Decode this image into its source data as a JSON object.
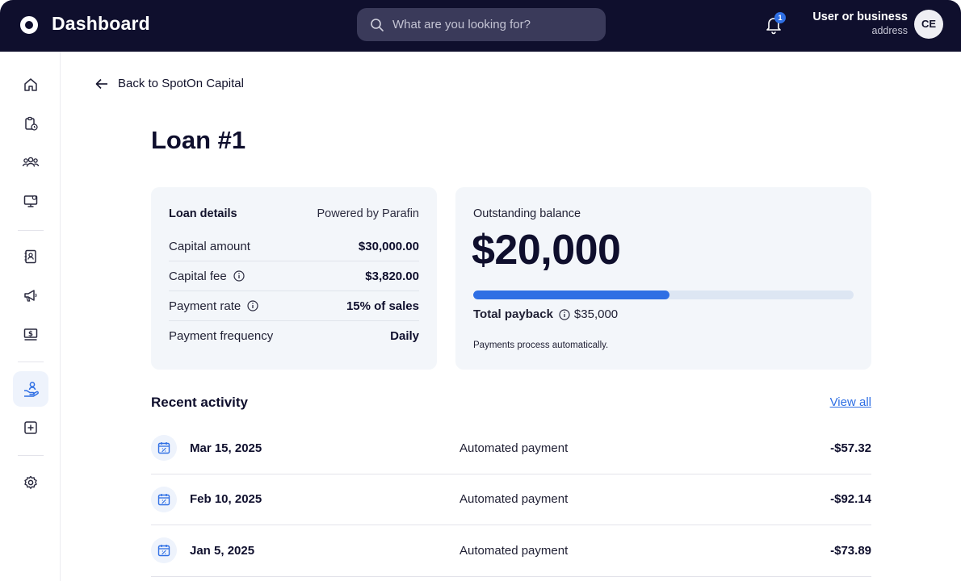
{
  "header": {
    "title": "Dashboard",
    "search_placeholder": "What are you looking for?",
    "notification_count": "1",
    "user_name": "User or business",
    "user_sub": "address",
    "avatar_initials": "CE"
  },
  "sidebar": {
    "items": [
      {
        "icon": "home-icon"
      },
      {
        "icon": "clipboard-clock-icon"
      },
      {
        "icon": "users-icon"
      },
      {
        "icon": "monitor-settings-icon"
      },
      {
        "icon": "contacts-book-icon"
      },
      {
        "icon": "megaphone-icon"
      },
      {
        "icon": "dollar-bill-icon"
      },
      {
        "icon": "hand-user-icon",
        "active": true
      },
      {
        "icon": "plus-square-icon"
      },
      {
        "icon": "gear-icon"
      }
    ]
  },
  "main": {
    "back_label": "Back to SpotOn Capital",
    "page_title": "Loan #1",
    "loan_details": {
      "title": "Loan details",
      "powered_by": "Powered by Parafin",
      "rows": [
        {
          "label": "Capital amount",
          "value": "$30,000.00",
          "info": false
        },
        {
          "label": "Capital fee",
          "value": "$3,820.00",
          "info": true
        },
        {
          "label": "Payment rate",
          "value": "15% of sales",
          "info": true
        },
        {
          "label": "Payment frequency",
          "value": "Daily",
          "info": false
        }
      ]
    },
    "balance": {
      "label": "Outstanding balance",
      "amount": "$20,000",
      "progress_fraction": 0.515,
      "payback_label": "Total payback",
      "payback_value": "$35,000",
      "note": "Payments process automatically."
    },
    "recent": {
      "title": "Recent activity",
      "view_all": "View all",
      "items": [
        {
          "date": "Mar 15, 2025",
          "description": "Automated payment",
          "amount": "-$57.32"
        },
        {
          "date": "Feb 10, 2025",
          "description": "Automated payment",
          "amount": "-$92.14"
        },
        {
          "date": "Jan 5, 2025",
          "description": "Automated payment",
          "amount": "-$73.89"
        }
      ]
    }
  },
  "colors": {
    "topbar": "#0f0f2d",
    "accent": "#2f6fe4",
    "card": "#f3f6fa"
  }
}
